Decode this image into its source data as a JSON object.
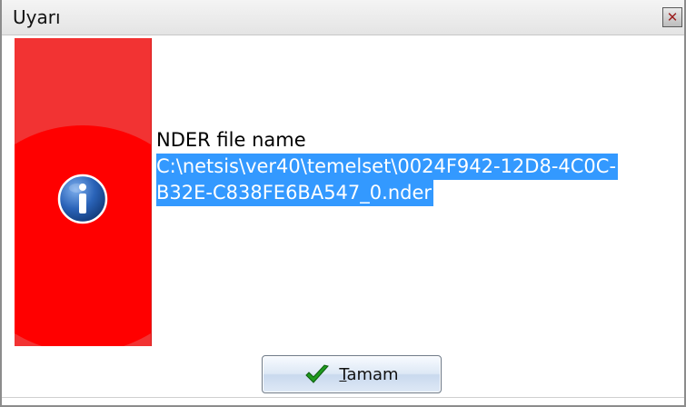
{
  "window": {
    "title": "Uyarı",
    "close_glyph": "✕"
  },
  "message": {
    "label": "NDER file name",
    "path_line1": "C:\\netsis\\ver40\\temelset\\0024F942-12D8-4C0C-",
    "path_line2": "B32E-C838FE6BA547_0.nder"
  },
  "buttons": {
    "ok_first": "T",
    "ok_rest": "amam"
  },
  "icons": {
    "info": "info-icon",
    "check": "check-icon",
    "close": "close-icon"
  },
  "colors": {
    "accent_red": "#ff0000",
    "panel_red": "#f23333",
    "selection_blue": "#3399ff",
    "check_green": "#1f9a1f",
    "info_blue": "#1a4f9c"
  }
}
